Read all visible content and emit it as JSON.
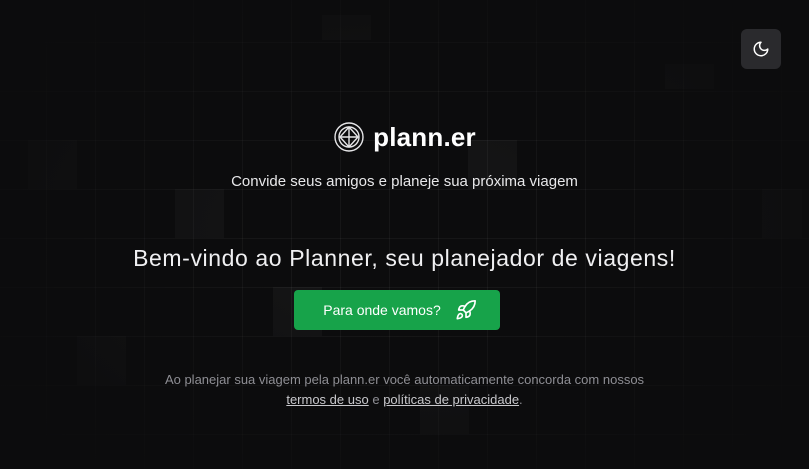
{
  "theme_toggle": {
    "icon": "moon-icon"
  },
  "brand": {
    "name": "plann.er",
    "logo_icon": "globe-icon"
  },
  "tagline": "Convide seus amigos e planeje sua próxima viagem",
  "welcome": "Bem-vindo ao Planner, seu planejador de viagens!",
  "cta": {
    "label": "Para onde vamos?",
    "icon": "rocket-icon",
    "color": "#17a34a"
  },
  "legal": {
    "prefix": "Ao planejar sua viagem pela plann.er você automaticamente concorda com nossos",
    "terms_link": "termos de uso",
    "conjunction": "e",
    "privacy_link": "políticas de privacidade",
    "suffix": "."
  }
}
